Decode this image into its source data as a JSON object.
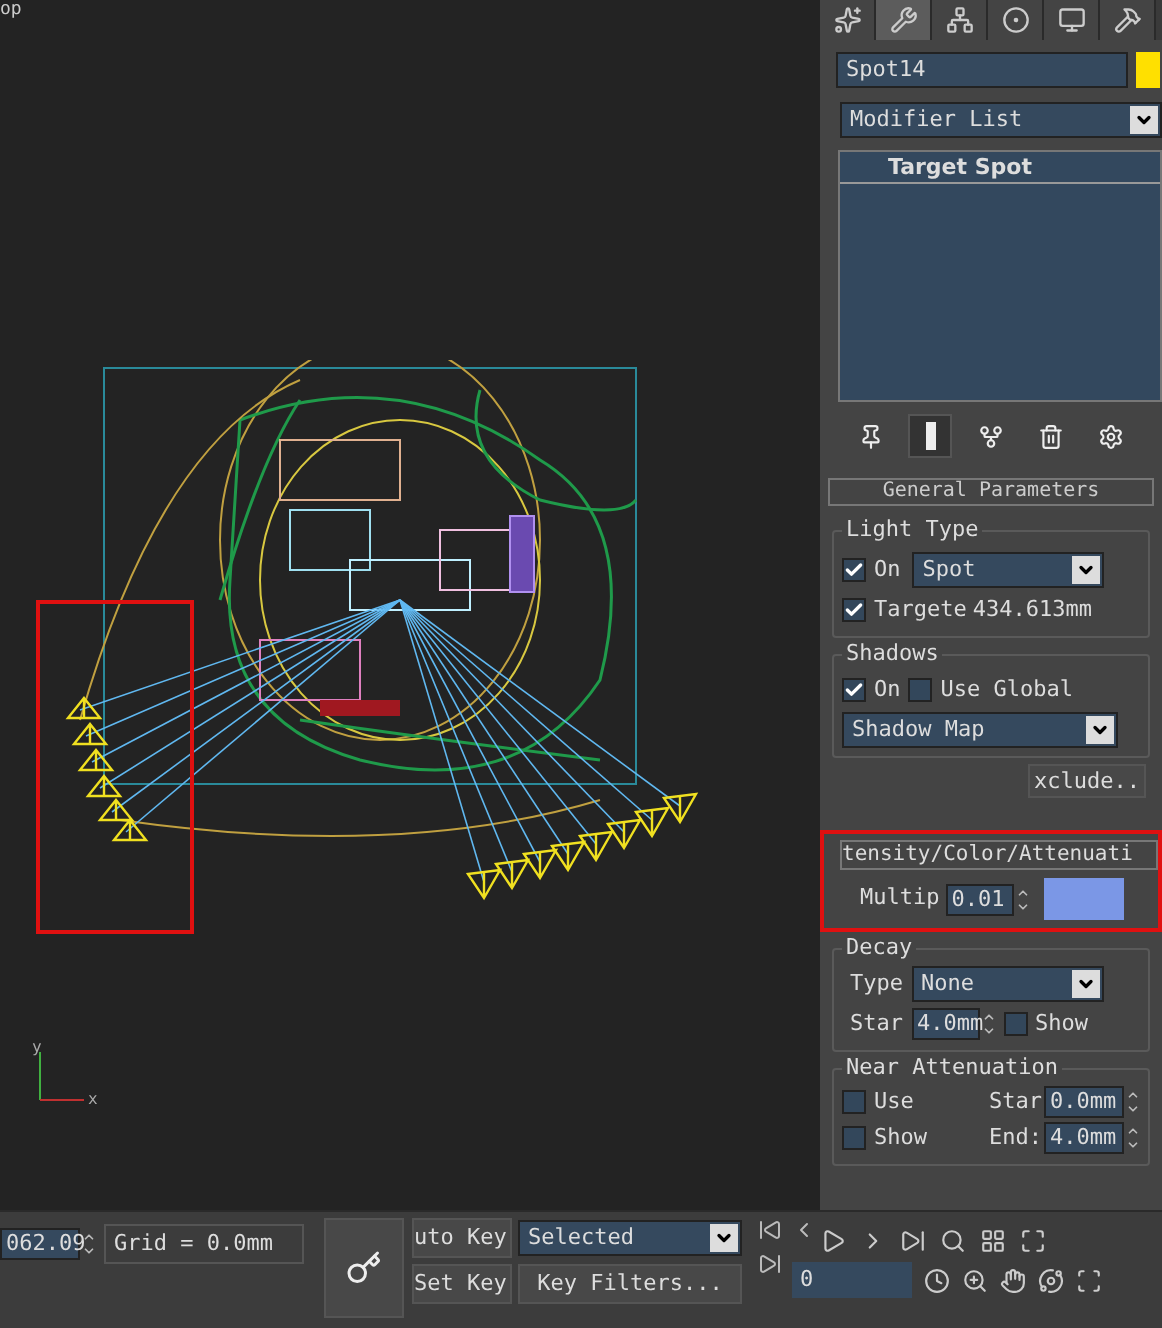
{
  "viewport": {
    "label": "op",
    "axis_labels": [
      "y",
      "x"
    ]
  },
  "command_tabs": [
    {
      "kind": "create",
      "selected": false
    },
    {
      "kind": "modify",
      "selected": true
    },
    {
      "kind": "hierarchy",
      "selected": false
    },
    {
      "kind": "motion",
      "selected": false
    },
    {
      "kind": "display",
      "selected": false
    },
    {
      "kind": "utilities",
      "selected": false
    }
  ],
  "object_name": "Spot14",
  "modifier_list": "Modifier List",
  "stack_items": [
    "Target Spot"
  ],
  "stack_tools": [
    {
      "kind": "pin",
      "selected": false
    },
    {
      "kind": "end_result",
      "selected": true
    },
    {
      "kind": "unique",
      "selected": false
    },
    {
      "kind": "remove",
      "selected": false
    },
    {
      "kind": "configure",
      "selected": false
    }
  ],
  "general_parameters": {
    "title": "General Parameters",
    "light_type": {
      "title": "Light Type",
      "on": {
        "label": "On",
        "checked": true
      },
      "type": "Spot",
      "targeted": {
        "label": "Targete",
        "checked": true
      },
      "distance": "434.613mm"
    },
    "shadows": {
      "title": "Shadows",
      "on": {
        "label": "On",
        "checked": true
      },
      "use_global": {
        "label": "Use Global",
        "checked": false
      },
      "type": "Shadow Map",
      "exclude": "xclude.."
    }
  },
  "intensity": {
    "title": "tensity/Color/Attenuati",
    "multiplier_label": "Multip",
    "multiplier": "0.01",
    "decay": {
      "title": "Decay",
      "type_label": "Type",
      "type": "None",
      "start_label": "Star",
      "start": "4.0mm",
      "show": {
        "label": "Show",
        "checked": false
      }
    },
    "near_attenuation": {
      "title": "Near Attenuation",
      "use": {
        "label": "Use",
        "checked": false
      },
      "show": {
        "label": "Show",
        "checked": false
      },
      "start_label": "Star",
      "start": "0.0mm",
      "end_label": "End:",
      "end": "4.0mm"
    }
  },
  "bottom_bar": {
    "frame": "062.09",
    "grid": "Grid = 0.0mm",
    "auto_key": "uto Key",
    "key_mode": "Selected",
    "set_key": "Set Key",
    "key_filters": "Key Filters...",
    "current_frame": "0"
  }
}
